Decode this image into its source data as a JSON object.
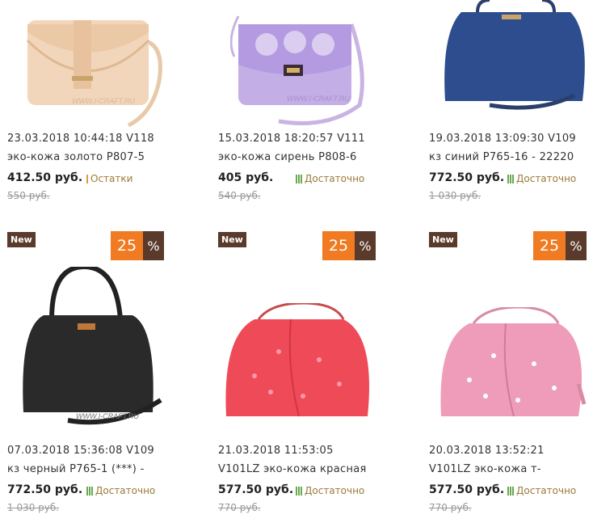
{
  "products": [
    {
      "title1": "23.03.2018 10:44:18 V118",
      "title2": "эко-кожа золото P807-5",
      "price": "412.50 руб.",
      "stock": "Остатки",
      "old_price": "550 руб.",
      "badge_new": "",
      "discount": "",
      "discount_sign": ""
    },
    {
      "title1": "15.03.2018 18:20:57 V111",
      "title2": "эко-кожа сирень P808-6",
      "price": "405 руб.",
      "stock": "Достаточно",
      "old_price": "540 руб.",
      "badge_new": "",
      "discount": "",
      "discount_sign": ""
    },
    {
      "title1": "19.03.2018 13:09:30 V109",
      "title2": "кз синий P765-16 - 22220",
      "price": "772.50 руб.",
      "stock": "Достаточно",
      "old_price": "1 030 руб.",
      "badge_new": "",
      "discount": "",
      "discount_sign": ""
    },
    {
      "title1": "07.03.2018 15:36:08 V109",
      "title2": "кз черный P765-1 (***) -",
      "price": "772.50 руб.",
      "stock": "Достаточно",
      "old_price": "1 030 руб.",
      "badge_new": "New",
      "discount": "25",
      "discount_sign": "%"
    },
    {
      "title1": "21.03.2018 11:53:05",
      "title2": "V101LZ эко-кожа красная",
      "price": "577.50 руб.",
      "stock": "Достаточно",
      "old_price": "770 руб.",
      "badge_new": "New",
      "discount": "25",
      "discount_sign": "%"
    },
    {
      "title1": "20.03.2018 13:52:21",
      "title2": "V101LZ эко-кожа т-",
      "price": "577.50 руб.",
      "stock": "Достаточно",
      "old_price": "770 руб.",
      "badge_new": "New",
      "discount": "25",
      "discount_sign": "%"
    }
  ],
  "watermark": "WWW.I-CRAFT.RU",
  "colors": {
    "discount": "#f07b22",
    "badge": "#5a3a2a",
    "stock_ok": "#6aa84f",
    "stock_low": "#e09b3b"
  }
}
